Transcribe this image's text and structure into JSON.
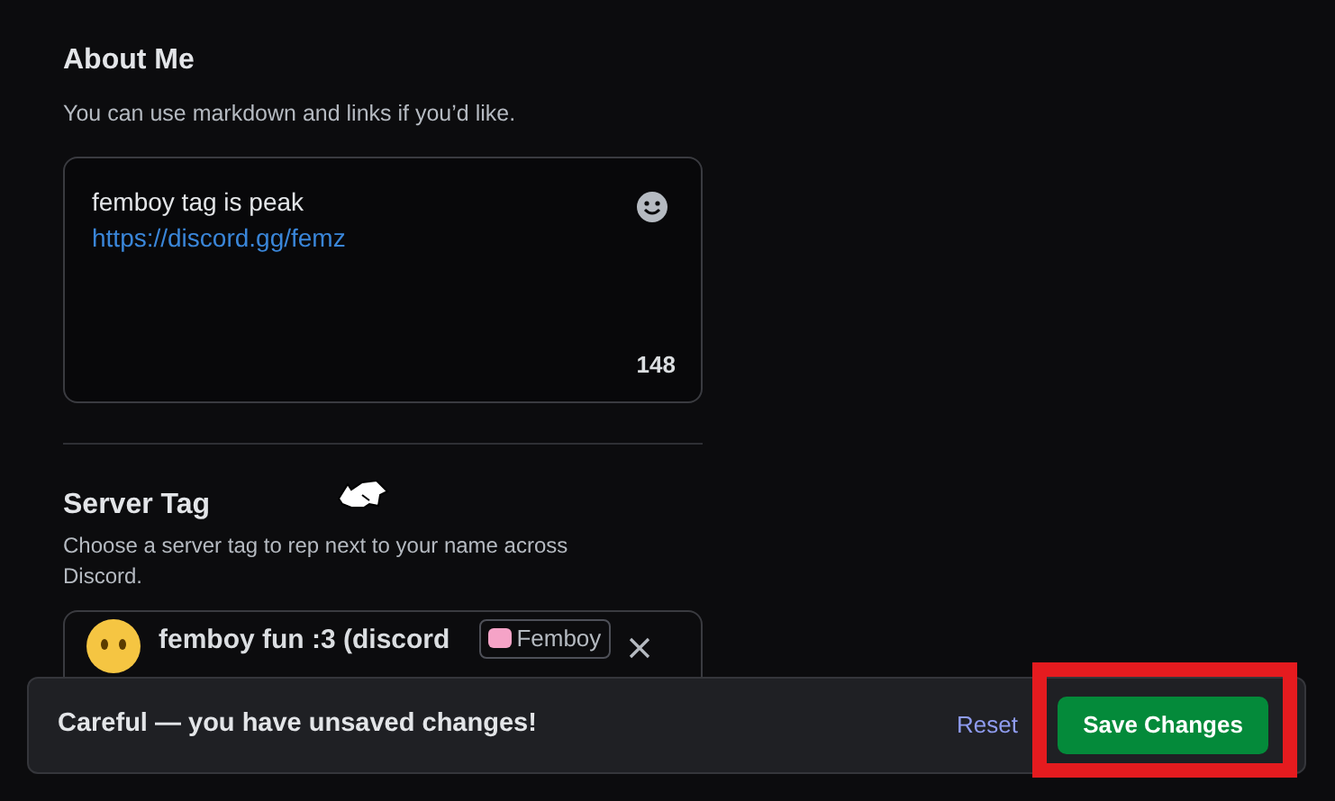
{
  "about_me": {
    "title": "About Me",
    "description": "You can use markdown and links if you’d like.",
    "text": "femboy tag is peak",
    "link": "https://discord.gg/femz",
    "remaining": "148"
  },
  "server_tag": {
    "title": "Server Tag",
    "description": "Choose a server tag to rep next to your name across Discord.",
    "server_name": "femboy fun :3 (discord",
    "tag": "Femboy"
  },
  "unsaved_bar": {
    "message": "Careful — you have unsaved changes!",
    "reset": "Reset",
    "save": "Save Changes",
    "highlighted": true
  }
}
